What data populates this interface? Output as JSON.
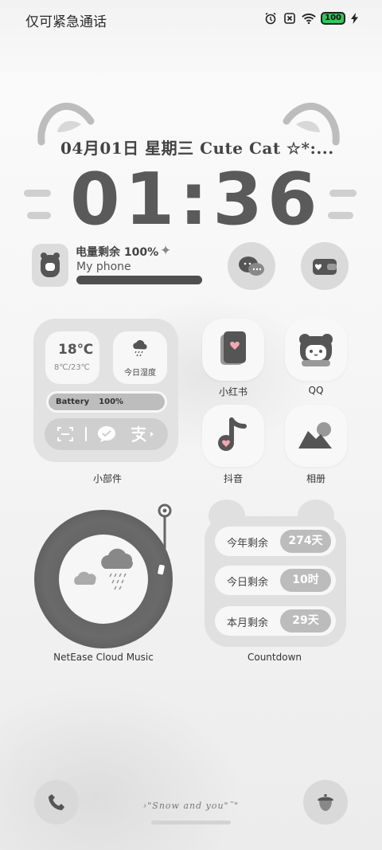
{
  "status_bar": {
    "carrier_text": "仅可紧急通话",
    "battery_level": "100",
    "icons": [
      "alarm-icon",
      "sim-off-icon",
      "wifi-icon",
      "battery-icon",
      "charging-bolt-icon"
    ]
  },
  "lock": {
    "date_text": "04月01日 星期三 Cute Cat ☆*:...",
    "time_text": "01:36"
  },
  "battery_widget": {
    "label": "电量剩余 100%",
    "device_name": "My phone",
    "level_fraction": 1.0,
    "sparkle": "✦"
  },
  "small_widget": {
    "temp_now": "18℃",
    "temp_range": "8℃/23℃",
    "humidity_label": "今日湿度",
    "battery_label": "Battery",
    "battery_value": "100%",
    "label": "小部件"
  },
  "apps": {
    "xiaohongshu": "小红书",
    "qq": "QQ",
    "douyin": "抖音",
    "gallery": "相册"
  },
  "music_widget": {
    "label": "NetEase Cloud Music"
  },
  "countdown": {
    "rows": [
      {
        "label": "今年剩余",
        "value": "274天"
      },
      {
        "label": "今日剩余",
        "value": "10时"
      },
      {
        "label": "本月剩余",
        "value": "29天"
      }
    ],
    "label": "Countdown"
  },
  "dock": {
    "caption": "›\"Snow and you\"˜\""
  },
  "colors": {
    "accent_pink": "#f6a5b5",
    "dark_gray": "#555555",
    "card_gray": "#e0e0e0",
    "charging_green": "#36c55a"
  }
}
